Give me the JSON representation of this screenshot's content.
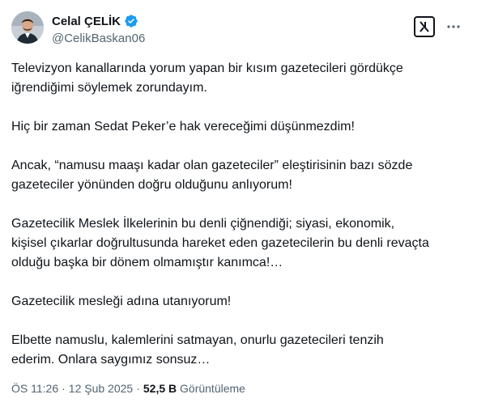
{
  "author": {
    "display_name": "Celal ÇELİK",
    "handle": "@CelikBaskan06",
    "verified": true
  },
  "icons": {
    "avatar": "profile-photo",
    "verified": "verified-badge-icon",
    "grok": "grok-icon",
    "more": "more-options-icon"
  },
  "colors": {
    "verified_blue": "#1d9bf0",
    "secondary_text": "#536471",
    "primary_text": "#0f1419"
  },
  "tweet": {
    "paragraphs": [
      [
        "Televizyon kanallarında yorum yapan bir kısım gazetecileri gördükçe",
        "iğrendiğimi söylemek zorundayım."
      ],
      [
        "Hiç bir zaman Sedat Peker’e hak vereceğimi düşünmezdim!"
      ],
      [
        "Ancak, “namusu maaşı kadar olan gazeteciler” eleştirisinin bazı sözde",
        "gazeteciler yönünden doğru olduğunu anlıyorum!"
      ],
      [
        "Gazetecilik Meslek İlkelerinin bu denli çiğnendiği; siyasi, ekonomik,",
        "kişisel çıkarlar doğrultusunda hareket eden gazetecilerin bu denli revaçta",
        "olduğu başka bir dönem olmamıştır kanımca!…"
      ],
      [
        "Gazetecilik mesleği adına utanıyorum!"
      ],
      [
        "Elbette namuslu, kalemlerini satmayan, onurlu gazetecileri tenzih",
        "ederim. Onlara saygımız sonsuz…"
      ]
    ]
  },
  "meta": {
    "time": "ÖS 11:26",
    "separator": "·",
    "date": "12 Şub 2025",
    "views_count": "52,5 B",
    "views_label": "Görüntüleme"
  }
}
